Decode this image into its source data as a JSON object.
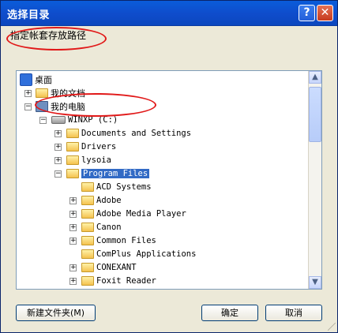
{
  "window": {
    "title": "选择目录",
    "help_label": "?",
    "close_label": "✕"
  },
  "prompt": "指定帐套存放路径",
  "tree": {
    "items": [
      {
        "label": "桌面",
        "icon": "desktop-icon"
      },
      {
        "label": "我的文档",
        "icon": "my-documents-icon"
      },
      {
        "label": "我的电脑",
        "icon": "my-computer-icon"
      },
      {
        "label": "WINXP (C:)",
        "icon": "drive-icon"
      },
      {
        "label": "Documents and Settings",
        "icon": "folder-icon"
      },
      {
        "label": "Drivers",
        "icon": "folder-icon"
      },
      {
        "label": "lysoia",
        "icon": "folder-icon"
      },
      {
        "label": "Program Files",
        "icon": "folder-icon"
      },
      {
        "label": "ACD Systems",
        "icon": "folder-icon"
      },
      {
        "label": "Adobe",
        "icon": "folder-icon"
      },
      {
        "label": "Adobe Media Player",
        "icon": "folder-icon"
      },
      {
        "label": "Canon",
        "icon": "folder-icon"
      },
      {
        "label": "Common Files",
        "icon": "folder-icon"
      },
      {
        "label": "ComPlus Applications",
        "icon": "folder-icon"
      },
      {
        "label": "CONEXANT",
        "icon": "folder-icon"
      },
      {
        "label": "Foxit Reader",
        "icon": "folder-icon"
      }
    ],
    "selected_index": 7
  },
  "buttons": {
    "new_folder": "新建文件夹(M)",
    "ok": "确定",
    "cancel": "取消"
  }
}
